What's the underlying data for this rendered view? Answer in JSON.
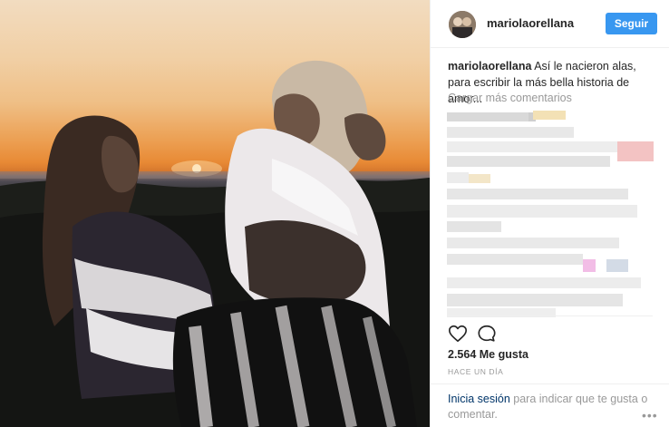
{
  "header": {
    "username": "mariolaorellana",
    "follow_label": "Seguir"
  },
  "caption": {
    "author": "mariolaorellana",
    "text": " Así le nacieron alas, para escribir la más bella historia de amor..."
  },
  "comments": {
    "load_more_label": "Cargar más comentarios"
  },
  "actions": {
    "like_icon": "heart-icon",
    "comment_icon": "comment-icon"
  },
  "stats": {
    "likes": "2.564 Me gusta",
    "timestamp": "HACE UN DÍA"
  },
  "footer": {
    "login_link": "Inicia sesión",
    "login_text": " para indicar que te gusta o comentar.",
    "more_icon": "more-options-icon"
  },
  "colors": {
    "accent": "#3897f0",
    "link": "#003569",
    "muted": "#999999"
  }
}
